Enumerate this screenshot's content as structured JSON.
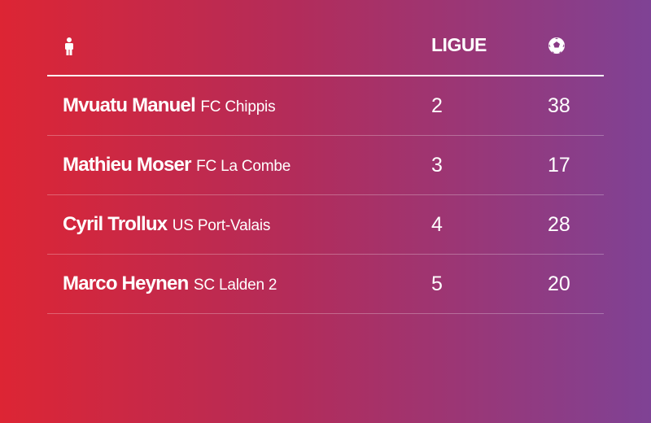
{
  "table": {
    "header": {
      "player_icon": "person-icon",
      "league_label": "LIGUE",
      "goals_icon": "soccer-ball-icon"
    },
    "rows": [
      {
        "name": "Mvuatu Manuel",
        "club": "FC Chippis",
        "league": "2",
        "goals": "38"
      },
      {
        "name": "Mathieu Moser",
        "club": "FC La Combe",
        "league": "3",
        "goals": "17"
      },
      {
        "name": "Cyril Trollux",
        "club": "US Port-Valais",
        "league": "4",
        "goals": "28"
      },
      {
        "name": "Marco Heynen",
        "club": "SC Lalden 2",
        "league": "5",
        "goals": "20"
      }
    ]
  },
  "colors": {
    "gradient_start": "#dd2534",
    "gradient_end": "#7f4295",
    "text": "#ffffff"
  }
}
